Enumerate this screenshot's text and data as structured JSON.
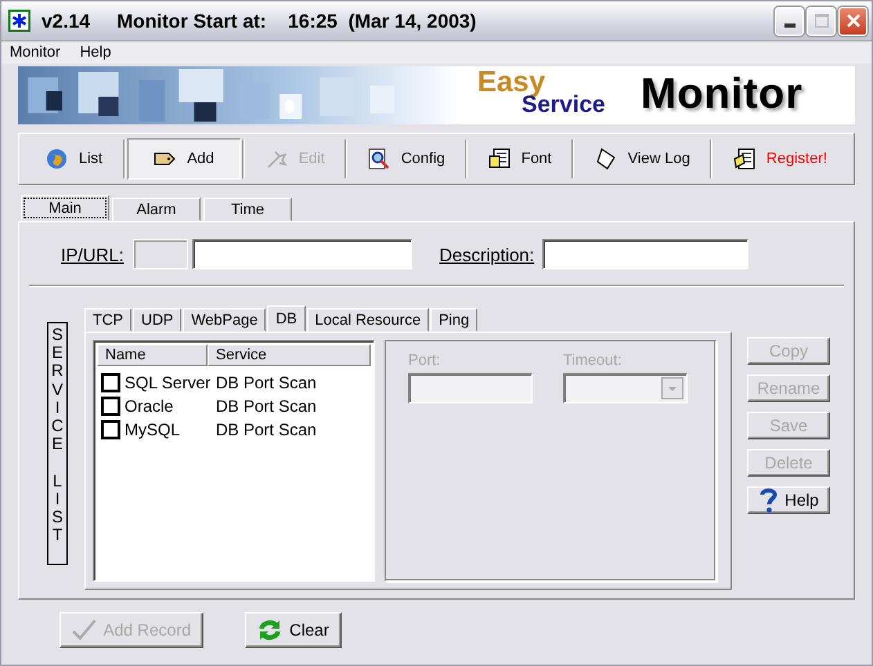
{
  "window": {
    "title": "v2.14     Monitor Start at:    16:25  (Mar 14, 2003)"
  },
  "menu": [
    "Monitor",
    "Help"
  ],
  "banner": {
    "easy": "Easy",
    "service": "Service",
    "monitor": "Monitor"
  },
  "toolbar": [
    {
      "label": "List",
      "selected": false,
      "disabled": false,
      "alert": false
    },
    {
      "label": "Add",
      "selected": true,
      "disabled": false,
      "alert": false
    },
    {
      "label": "Edit",
      "selected": false,
      "disabled": true,
      "alert": false
    },
    {
      "label": "Config",
      "selected": false,
      "disabled": false,
      "alert": false
    },
    {
      "label": "Font",
      "selected": false,
      "disabled": false,
      "alert": false
    },
    {
      "label": "View Log",
      "selected": false,
      "disabled": false,
      "alert": false
    },
    {
      "label": "Register!",
      "selected": false,
      "disabled": false,
      "alert": true
    }
  ],
  "tabs": [
    {
      "label": "Main",
      "selected": true
    },
    {
      "label": "Alarm",
      "selected": false
    },
    {
      "label": "Time",
      "selected": false
    }
  ],
  "ip_url": {
    "label": "IP/URL:"
  },
  "description": {
    "label": "Description:"
  },
  "service_list_label": "SERVICE LIST",
  "service_tabs": [
    {
      "label": "TCP",
      "selected": false
    },
    {
      "label": "UDP",
      "selected": false
    },
    {
      "label": "WebPage",
      "selected": false
    },
    {
      "label": "DB",
      "selected": true
    },
    {
      "label": "Local Resource",
      "selected": false
    },
    {
      "label": "Ping",
      "selected": false
    }
  ],
  "table": {
    "columns": [
      "Name",
      "Service"
    ],
    "rows": [
      {
        "name": "SQL Server",
        "service": "DB Port Scan",
        "checked": false
      },
      {
        "name": "Oracle",
        "service": "DB Port Scan",
        "checked": false
      },
      {
        "name": "MySQL",
        "service": "DB Port Scan",
        "checked": false
      }
    ]
  },
  "port": {
    "label": "Port:",
    "disabled": true
  },
  "timeout": {
    "label": "Timeout:",
    "disabled": true
  },
  "side_buttons": [
    {
      "label": "Copy",
      "disabled": true
    },
    {
      "label": "Rename",
      "disabled": true
    },
    {
      "label": "Save",
      "disabled": true
    },
    {
      "label": "Delete",
      "disabled": true
    },
    {
      "label": "Help",
      "disabled": false
    }
  ],
  "bottom_buttons": [
    {
      "label": "Add Record",
      "disabled": true
    },
    {
      "label": "Clear",
      "disabled": false
    }
  ]
}
